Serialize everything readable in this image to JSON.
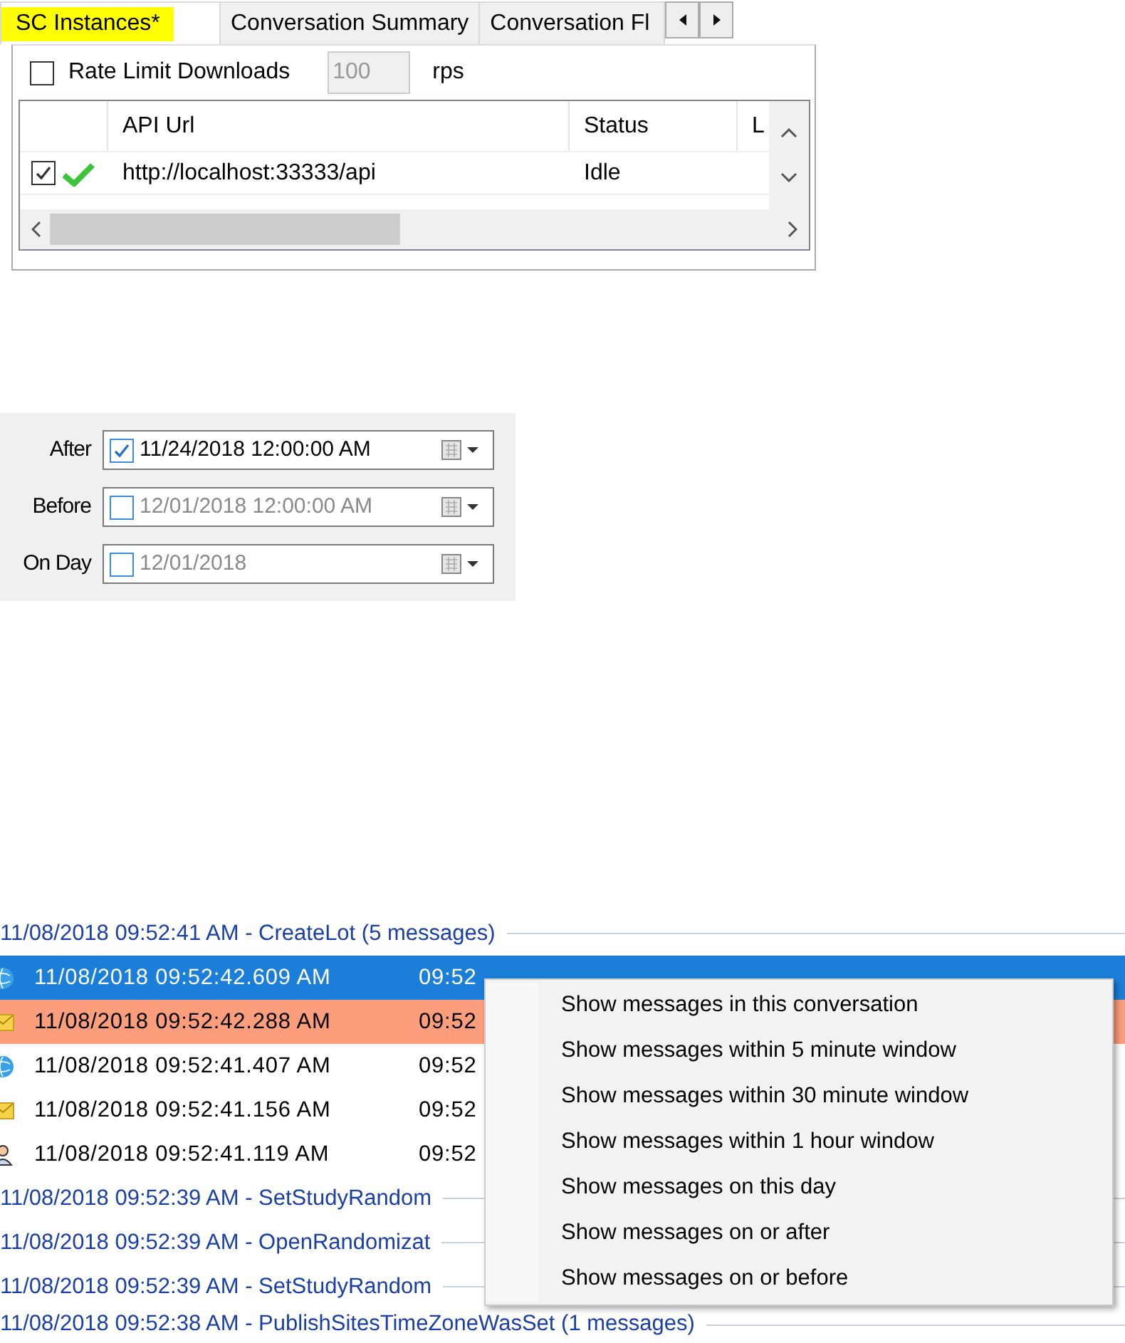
{
  "tabs": [
    {
      "label": "SC Instances*",
      "selected": true,
      "highlighted": true
    },
    {
      "label": "Conversation Summary",
      "selected": false,
      "highlighted": false
    },
    {
      "label": "Conversation Fl",
      "selected": false,
      "highlighted": false
    }
  ],
  "rate_limit": {
    "label": "Rate Limit Downloads",
    "checked": false,
    "value": "100",
    "unit": "rps"
  },
  "instances_table": {
    "columns": [
      "API Url",
      "Status",
      "L"
    ],
    "rows": [
      {
        "checked": true,
        "url": "http://localhost:33333/api",
        "status": "Idle"
      }
    ]
  },
  "date_filters": [
    {
      "label": "After",
      "checked": true,
      "value": "11/24/2018 12:00:00 AM"
    },
    {
      "label": "Before",
      "checked": false,
      "value": "12/01/2018 12:00:00 AM"
    },
    {
      "label": "On Day",
      "checked": false,
      "value": "12/01/2018"
    }
  ],
  "messages": [
    {
      "kind": "group",
      "text": "11/08/2018 09:52:41 AM - CreateLot (5 messages)"
    },
    {
      "kind": "web",
      "selected": true,
      "flagged": false,
      "time": "11/08/2018 09:52:42.609 AM",
      "time_2": "09:52"
    },
    {
      "kind": "mail",
      "selected": false,
      "flagged": true,
      "time": "11/08/2018 09:52:42.288 AM",
      "time_2": "09:52"
    },
    {
      "kind": "web",
      "selected": false,
      "flagged": false,
      "time": "11/08/2018 09:52:41.407 AM",
      "time_2": "09:52"
    },
    {
      "kind": "mail",
      "selected": false,
      "flagged": false,
      "time": "11/08/2018 09:52:41.156 AM",
      "time_2": "09:52"
    },
    {
      "kind": "user",
      "selected": false,
      "flagged": false,
      "time": "11/08/2018 09:52:41.119 AM",
      "time_2": "09:52"
    },
    {
      "kind": "group",
      "text": "11/08/2018 09:52:39 AM - SetStudyRandom"
    },
    {
      "kind": "group",
      "text": "11/08/2018 09:52:39 AM - OpenRandomizat"
    },
    {
      "kind": "group",
      "text": "11/08/2018 09:52:39 AM - SetStudyRandom"
    },
    {
      "kind": "group",
      "text": "11/08/2018 09:52:38 AM - PublishSitesTimeZoneWasSet (1 messages)"
    }
  ],
  "context_menu": [
    "Show messages in this conversation",
    "Show messages within 5 minute window",
    "Show messages within 30 minute window",
    "Show messages within 1 hour window",
    "Show messages on this day",
    "Show messages on or after",
    "Show messages on or before"
  ]
}
